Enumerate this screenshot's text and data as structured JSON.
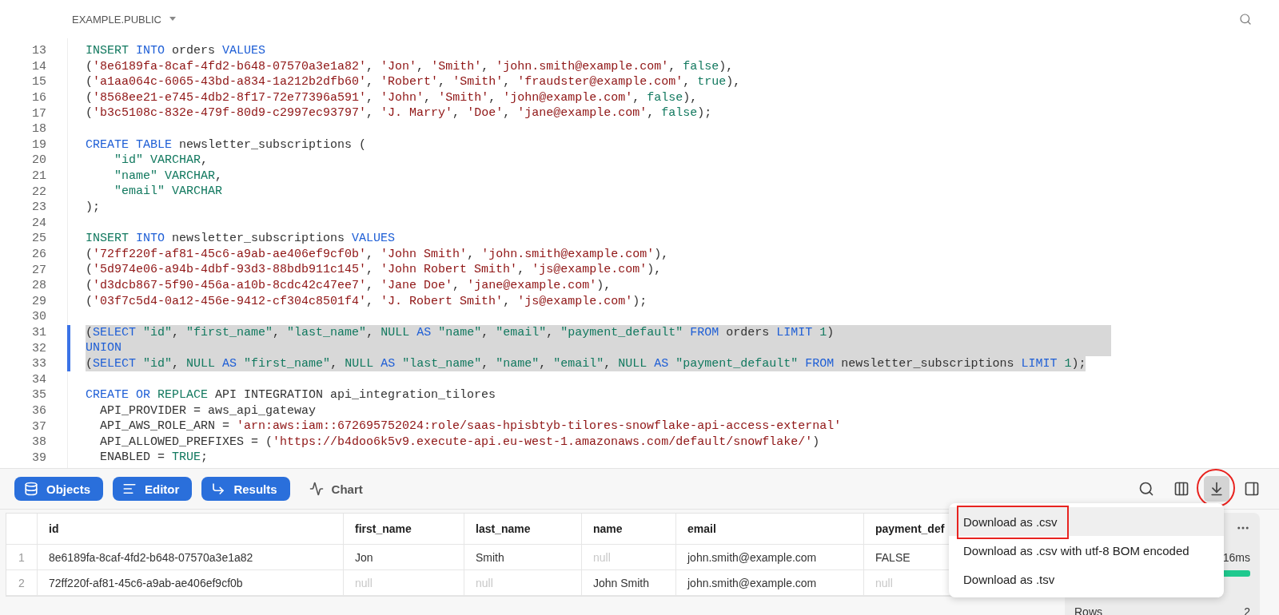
{
  "header": {
    "schema": "EXAMPLE.PUBLIC"
  },
  "code_lines": [
    {
      "number": "13",
      "selected": false,
      "tokens": [
        {
          "kind": "g",
          "text": "INSERT "
        },
        {
          "kind": "k",
          "text": "INTO"
        },
        {
          "kind": "p",
          "text": " orders "
        },
        {
          "kind": "k",
          "text": "VALUES"
        }
      ]
    },
    {
      "number": "14",
      "selected": false,
      "tokens": [
        {
          "kind": "p",
          "text": "("
        },
        {
          "kind": "s",
          "text": "'8e6189fa-8caf-4fd2-b648-07570a3e1a82'"
        },
        {
          "kind": "p",
          "text": ", "
        },
        {
          "kind": "s",
          "text": "'Jon'"
        },
        {
          "kind": "p",
          "text": ", "
        },
        {
          "kind": "s",
          "text": "'Smith'"
        },
        {
          "kind": "p",
          "text": ", "
        },
        {
          "kind": "s",
          "text": "'john.smith@example.com'"
        },
        {
          "kind": "p",
          "text": ", "
        },
        {
          "kind": "g",
          "text": "false"
        },
        {
          "kind": "p",
          "text": "),"
        }
      ]
    },
    {
      "number": "15",
      "selected": false,
      "tokens": [
        {
          "kind": "p",
          "text": "("
        },
        {
          "kind": "s",
          "text": "'a1aa064c-6065-43bd-a834-1a212b2dfb60'"
        },
        {
          "kind": "p",
          "text": ", "
        },
        {
          "kind": "s",
          "text": "'Robert'"
        },
        {
          "kind": "p",
          "text": ", "
        },
        {
          "kind": "s",
          "text": "'Smith'"
        },
        {
          "kind": "p",
          "text": ", "
        },
        {
          "kind": "s",
          "text": "'fraudster@example.com'"
        },
        {
          "kind": "p",
          "text": ", "
        },
        {
          "kind": "g",
          "text": "true"
        },
        {
          "kind": "p",
          "text": "),"
        }
      ]
    },
    {
      "number": "16",
      "selected": false,
      "tokens": [
        {
          "kind": "p",
          "text": "("
        },
        {
          "kind": "s",
          "text": "'8568ee21-e745-4db2-8f17-72e77396a591'"
        },
        {
          "kind": "p",
          "text": ", "
        },
        {
          "kind": "s",
          "text": "'John'"
        },
        {
          "kind": "p",
          "text": ", "
        },
        {
          "kind": "s",
          "text": "'Smith'"
        },
        {
          "kind": "p",
          "text": ", "
        },
        {
          "kind": "s",
          "text": "'john@example.com'"
        },
        {
          "kind": "p",
          "text": ", "
        },
        {
          "kind": "g",
          "text": "false"
        },
        {
          "kind": "p",
          "text": "),"
        }
      ]
    },
    {
      "number": "17",
      "selected": false,
      "tokens": [
        {
          "kind": "p",
          "text": "("
        },
        {
          "kind": "s",
          "text": "'b3c5108c-832e-479f-80d9-c2997ec93797'"
        },
        {
          "kind": "p",
          "text": ", "
        },
        {
          "kind": "s",
          "text": "'J. Marry'"
        },
        {
          "kind": "p",
          "text": ", "
        },
        {
          "kind": "s",
          "text": "'Doe'"
        },
        {
          "kind": "p",
          "text": ", "
        },
        {
          "kind": "s",
          "text": "'jane@example.com'"
        },
        {
          "kind": "p",
          "text": ", "
        },
        {
          "kind": "g",
          "text": "false"
        },
        {
          "kind": "p",
          "text": ");"
        }
      ]
    },
    {
      "number": "18",
      "selected": false
    },
    {
      "number": "19",
      "selected": false,
      "tokens": [
        {
          "kind": "k",
          "text": "CREATE TABLE"
        },
        {
          "kind": "p",
          "text": " newsletter_subscriptions ("
        }
      ]
    },
    {
      "number": "20",
      "selected": false,
      "tokens": [
        {
          "kind": "g",
          "text": "    \"id\" VARCHAR"
        },
        {
          "kind": "p",
          "text": ","
        }
      ]
    },
    {
      "number": "21",
      "selected": false,
      "tokens": [
        {
          "kind": "g",
          "text": "    \"name\" VARCHAR"
        },
        {
          "kind": "p",
          "text": ","
        }
      ]
    },
    {
      "number": "22",
      "selected": false,
      "tokens": [
        {
          "kind": "g",
          "text": "    \"email\" VARCHAR"
        }
      ]
    },
    {
      "number": "23",
      "selected": false,
      "tokens": [
        {
          "kind": "p",
          "text": ");"
        }
      ]
    },
    {
      "number": "24",
      "selected": false
    },
    {
      "number": "25",
      "selected": false,
      "tokens": [
        {
          "kind": "g",
          "text": "INSERT "
        },
        {
          "kind": "k",
          "text": "INTO"
        },
        {
          "kind": "p",
          "text": " newsletter_subscriptions "
        },
        {
          "kind": "k",
          "text": "VALUES"
        }
      ]
    },
    {
      "number": "26",
      "selected": false,
      "tokens": [
        {
          "kind": "p",
          "text": "("
        },
        {
          "kind": "s",
          "text": "'72ff220f-af81-45c6-a9ab-ae406ef9cf0b'"
        },
        {
          "kind": "p",
          "text": ", "
        },
        {
          "kind": "s",
          "text": "'John Smith'"
        },
        {
          "kind": "p",
          "text": ", "
        },
        {
          "kind": "s",
          "text": "'john.smith@example.com'"
        },
        {
          "kind": "p",
          "text": "),"
        }
      ]
    },
    {
      "number": "27",
      "selected": false,
      "tokens": [
        {
          "kind": "p",
          "text": "("
        },
        {
          "kind": "s",
          "text": "'5d974e06-a94b-4dbf-93d3-88bdb911c145'"
        },
        {
          "kind": "p",
          "text": ", "
        },
        {
          "kind": "s",
          "text": "'John Robert Smith'"
        },
        {
          "kind": "p",
          "text": ", "
        },
        {
          "kind": "s",
          "text": "'js@example.com'"
        },
        {
          "kind": "p",
          "text": "),"
        }
      ]
    },
    {
      "number": "28",
      "selected": false,
      "tokens": [
        {
          "kind": "p",
          "text": "("
        },
        {
          "kind": "s",
          "text": "'d3dcb867-5f90-456a-a10b-8cdc42c47ee7'"
        },
        {
          "kind": "p",
          "text": ", "
        },
        {
          "kind": "s",
          "text": "'Jane Doe'"
        },
        {
          "kind": "p",
          "text": ", "
        },
        {
          "kind": "s",
          "text": "'jane@example.com'"
        },
        {
          "kind": "p",
          "text": "),"
        }
      ]
    },
    {
      "number": "29",
      "selected": false,
      "tokens": [
        {
          "kind": "p",
          "text": "("
        },
        {
          "kind": "s",
          "text": "'03f7c5d4-0a12-456e-9412-cf304c8501f4'"
        },
        {
          "kind": "p",
          "text": ", "
        },
        {
          "kind": "s",
          "text": "'J. Robert Smith'"
        },
        {
          "kind": "p",
          "text": ", "
        },
        {
          "kind": "s",
          "text": "'js@example.com'"
        },
        {
          "kind": "p",
          "text": ");"
        }
      ]
    },
    {
      "number": "30",
      "selected": false
    },
    {
      "number": "31",
      "selected": true,
      "tokens": [
        {
          "kind": "p",
          "text": "("
        },
        {
          "kind": "k",
          "text": "SELECT "
        },
        {
          "kind": "g",
          "text": "\"id\""
        },
        {
          "kind": "p",
          "text": ", "
        },
        {
          "kind": "g",
          "text": "\"first_name\""
        },
        {
          "kind": "p",
          "text": ", "
        },
        {
          "kind": "g",
          "text": "\"last_name\""
        },
        {
          "kind": "p",
          "text": ", "
        },
        {
          "kind": "g",
          "text": "NULL "
        },
        {
          "kind": "k",
          "text": "AS "
        },
        {
          "kind": "g",
          "text": "\"name\""
        },
        {
          "kind": "p",
          "text": ", "
        },
        {
          "kind": "g",
          "text": "\"email\""
        },
        {
          "kind": "p",
          "text": ", "
        },
        {
          "kind": "g",
          "text": "\"payment_default\" "
        },
        {
          "kind": "k",
          "text": "FROM"
        },
        {
          "kind": "p",
          "text": " orders "
        },
        {
          "kind": "k",
          "text": "LIMIT "
        },
        {
          "kind": "g",
          "text": "1"
        },
        {
          "kind": "p",
          "text": ")"
        }
      ]
    },
    {
      "number": "32",
      "selected": true,
      "tokens": [
        {
          "kind": "k",
          "text": "UNION"
        }
      ]
    },
    {
      "number": "33",
      "selected": true,
      "tokens": [
        {
          "kind": "p",
          "text": "("
        },
        {
          "kind": "k",
          "text": "SELECT "
        },
        {
          "kind": "g",
          "text": "\"id\""
        },
        {
          "kind": "p",
          "text": ", "
        },
        {
          "kind": "g",
          "text": "NULL "
        },
        {
          "kind": "k",
          "text": "AS "
        },
        {
          "kind": "g",
          "text": "\"first_name\""
        },
        {
          "kind": "p",
          "text": ", "
        },
        {
          "kind": "g",
          "text": "NULL "
        },
        {
          "kind": "k",
          "text": "AS "
        },
        {
          "kind": "g",
          "text": "\"last_name\""
        },
        {
          "kind": "p",
          "text": ", "
        },
        {
          "kind": "g",
          "text": "\"name\""
        },
        {
          "kind": "p",
          "text": ", "
        },
        {
          "kind": "g",
          "text": "\"email\""
        },
        {
          "kind": "p",
          "text": ", "
        },
        {
          "kind": "g",
          "text": "NULL "
        },
        {
          "kind": "k",
          "text": "AS "
        },
        {
          "kind": "g",
          "text": "\"payment_default\" "
        },
        {
          "kind": "k",
          "text": "FROM"
        },
        {
          "kind": "p",
          "text": " newsletter_subscriptions "
        },
        {
          "kind": "k",
          "text": "LIMIT "
        },
        {
          "kind": "g",
          "text": "1"
        },
        {
          "kind": "p",
          "text": ");"
        }
      ]
    },
    {
      "number": "34",
      "selected": false
    },
    {
      "number": "35",
      "selected": false,
      "tokens": [
        {
          "kind": "k",
          "text": "CREATE OR "
        },
        {
          "kind": "g",
          "text": "REPLACE"
        },
        {
          "kind": "p",
          "text": " API INTEGRATION api_integration_tilores"
        }
      ]
    },
    {
      "number": "36",
      "selected": false,
      "tokens": [
        {
          "kind": "p",
          "text": "  API_PROVIDER = aws_api_gateway"
        }
      ]
    },
    {
      "number": "37",
      "selected": false,
      "tokens": [
        {
          "kind": "p",
          "text": "  API_AWS_ROLE_ARN = "
        },
        {
          "kind": "s",
          "text": "'arn:aws:iam::672695752024:role/saas-hpisbtyb-tilores-snowflake-api-access-external'"
        }
      ]
    },
    {
      "number": "38",
      "selected": false,
      "tokens": [
        {
          "kind": "p",
          "text": "  API_ALLOWED_PREFIXES = ("
        },
        {
          "kind": "s",
          "text": "'https://b4doo6k5v9.execute-api.eu-west-1.amazonaws.com/default/snowflake/'"
        },
        {
          "kind": "p",
          "text": ")"
        }
      ]
    },
    {
      "number": "39",
      "selected": false,
      "tokens": [
        {
          "kind": "p",
          "text": "  ENABLED = "
        },
        {
          "kind": "g",
          "text": "TRUE"
        },
        {
          "kind": "p",
          "text": ";"
        }
      ]
    }
  ],
  "view_buttons": [
    {
      "label": "Objects",
      "on": true
    },
    {
      "label": "Editor",
      "on": true
    },
    {
      "label": "Results",
      "on": true
    },
    {
      "label": "Chart",
      "on": false
    }
  ],
  "result_tools": [
    {
      "kind": "search",
      "pressed": false,
      "circled": false
    },
    {
      "kind": "columns",
      "pressed": false,
      "circled": false
    },
    {
      "kind": "download",
      "pressed": true,
      "circled": true
    },
    {
      "kind": "panel",
      "pressed": false,
      "circled": false
    }
  ],
  "table": {
    "columns": [
      "id",
      "first_name",
      "last_name",
      "name",
      "email",
      "payment_def"
    ],
    "rows": [
      {
        "number": "1",
        "cells": [
          {
            "text": "8e6189fa-8caf-4fd2-b648-07570a3e1a82",
            "null": false
          },
          {
            "text": "Jon",
            "null": false
          },
          {
            "text": "Smith",
            "null": false
          },
          {
            "text": "null",
            "null": true
          },
          {
            "text": "john.smith@example.com",
            "null": false
          },
          {
            "text": "FALSE",
            "null": false
          }
        ]
      },
      {
        "number": "2",
        "cells": [
          {
            "text": "72ff220f-af81-45c6-a9ab-ae406ef9cf0b",
            "null": false
          },
          {
            "text": "null",
            "null": true
          },
          {
            "text": "null",
            "null": true
          },
          {
            "text": "John Smith",
            "null": false
          },
          {
            "text": "john.smith@example.com",
            "null": false
          },
          {
            "text": "null",
            "null": true
          }
        ]
      }
    ]
  },
  "stats_panel": {
    "duration": "16ms",
    "rows_label": "Rows",
    "rows_value": "2"
  },
  "download_menu": [
    {
      "label": "Download as .csv",
      "selected": true,
      "boxed": true
    },
    {
      "label": "Download as .csv with utf-8 BOM encoded",
      "selected": false,
      "boxed": false
    },
    {
      "label": "Download as .tsv",
      "selected": false,
      "boxed": false
    }
  ]
}
